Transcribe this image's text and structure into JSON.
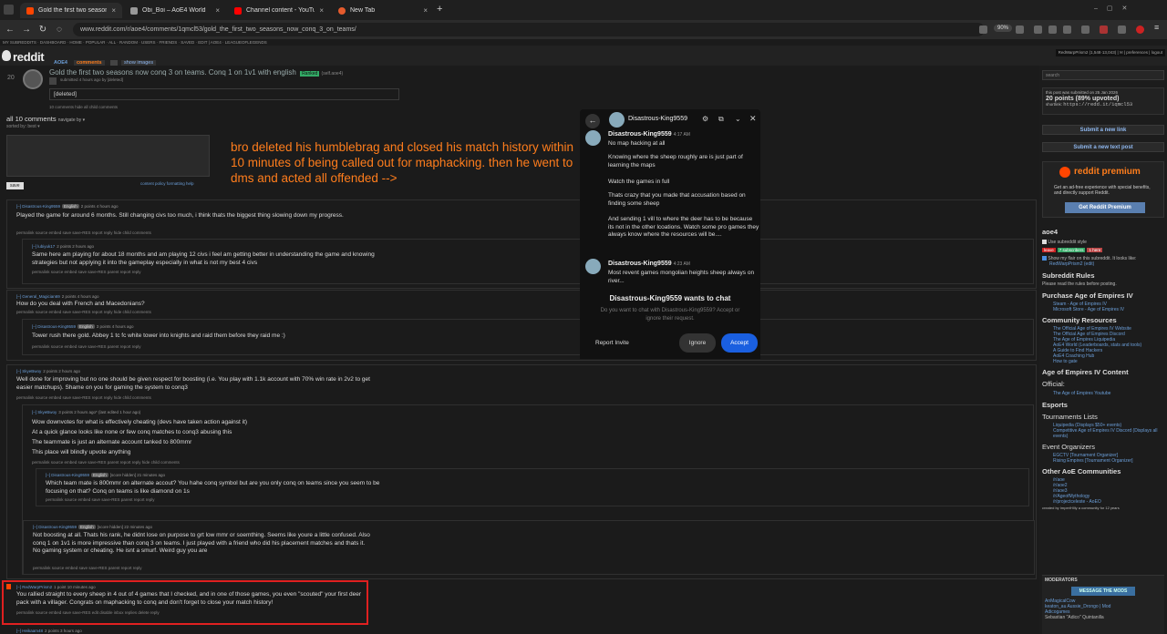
{
  "browser": {
    "tabs": [
      {
        "title": "Gold the first two seasons now",
        "color": "#ff4500"
      },
      {
        "title": "Obi_Boi – AoE4 World",
        "color": "#888888"
      },
      {
        "title": "Channel content - YouTube Stu",
        "color": "#ff0000"
      },
      {
        "title": "New Tab",
        "color": "#e55b2d"
      }
    ],
    "url": "www.reddit.com/r/aoe4/comments/1qmcl53/gold_the_first_two_seasons_now_conq_3_on_teams/",
    "zoom": "90%"
  },
  "srbar": "MY SUBREDDITS · DASHBOARD · HOME · POPULAR · ALL · RANDOM · USERS · FRIENDS · SAVED · EDIT | AOE4 · LEAGUEOFLEGENDS",
  "header": {
    "logo": "reddit",
    "subreddit": "AOE4",
    "tab_comments": "comments",
    "tab_images": "show images",
    "user": "RedWarpPrism2 (1,548·13,043) | ✉ | preferences | logout"
  },
  "post": {
    "score": "20",
    "title": "Gold the first two seasons now conq 3 on teams. Conq 1 on 1v1 with english",
    "flair": "Ranked",
    "domain": "(self.aoe4)",
    "tagline": "submitted 4 hours ago by [deleted]",
    "body": "[deleted]",
    "links": "10 comments   hide all child comments"
  },
  "comments_header": {
    "all": "all 10 comments",
    "navigate": "navigate by ▾",
    "sorted": "sorted by: best ▾",
    "content_policy": "content policy   formatting help",
    "save": "save"
  },
  "annotation": "bro deleted his humblebrag and closed his match history within 10 minutes of being called out for maphacking. then he went to dms and acted all offended -->",
  "comments": [
    {
      "head": "[–] Disastrous-King9559",
      "badge": "English",
      "meta": "2 points 4 hours ago",
      "text": "Played the game for around 6 months. Still changing civs too much, i think thats the biggest thing slowing down my progress.",
      "links": "permalink  source  embed  save  save-RES  report  reply  hide child comments"
    },
    {
      "head": "[–] lubiyuk17",
      "badge": "",
      "meta": "2 points 2 hours ago",
      "text": "Same here am playing for about 18 months and am playing 12 civs i feel am getting better in understanding the game and knowing strategies but not applying it into the gameplay especially in what is not my best 4 civs",
      "links": "permalink  source  embed  save  save-RES  parent  report  reply"
    },
    {
      "head": "[–] General_Magician69",
      "badge": "",
      "meta": "2 points 4 hours ago",
      "text": "How do you deal with French and Macedonians?",
      "links": "permalink  source  embed  save  save-RES  report  reply  hide child comments"
    },
    {
      "head": "[–] Disastrous-King9559",
      "badge": "English",
      "meta": "3 points 4 hours ago",
      "text": "Tower rush there gold. Abbey 1 tc fc white tower into knights and raid them before they raid me :)",
      "links": "permalink  source  embed  save  save-RES  parent  report  reply"
    },
    {
      "head": "[–] SkyeBwoy",
      "badge": "",
      "meta": "2 points 2 hours ago",
      "text": "Well done for improving but no one should be given respect for boosting (i.e. You play with 1.1k account with 70% win rate in 2v2 to get easier matchups). Shame on you for gaming the system to conq3",
      "links": "permalink  source  embed  save  save-RES  report  reply  hide child comments"
    },
    {
      "head": "[–] SkyeBwoy",
      "badge": "",
      "meta": "3 points 2 hours ago* (last edited 1 hour ago)",
      "text": "Wow downvotes for what is effectively cheating (devs have taken action against it)",
      "text2": "At a quick glance looks like none or few conq matches to conq3 abusing this",
      "text3": "The teammate is just an alternate account tanked to 800mmr",
      "text4": "This place will blindly upvote anything",
      "links": "permalink  source  embed  save  save-RES  parent  report  reply  hide child comments"
    },
    {
      "head": "[–] Disastrous-King9559",
      "badge": "English",
      "meta": "[score hidden] 21 minutes ago",
      "text": "Which team mate is 800mmr on alternate accout? You hahe conq symbol but are you only conq on teams since you seem to be focusing on that? Conq on teams is like diamond on 1s",
      "links": "permalink  source  embed  save  save-RES  parent  report  reply"
    },
    {
      "head": "[–] Disastrous-King9559",
      "badge": "English",
      "meta": "[score hidden] 22 minutes ago",
      "text": "Not boosting at all. Thats his rank, he didnt lose on purpose to grt low mmr or soemthing. Seems like youre a little confused. Also conq 1 on 1v1 is more impressive than conq 3 on teams. I just played with a friend who did his placement matches and thats it. No gaming system or cheating. He isnt a smurf. Weird guy you are",
      "links": "permalink  source  embed  save  save-RES  parent  report  reply"
    },
    {
      "head": "[–] RedWarpPrism2",
      "badge": "",
      "meta": "1 point 10 minutes ago",
      "text": "You rallied straight to every sheep in 4 out of 4 games that I checked, and in one of those games, you even \"scouted\" your first deer pack with a villager. Congrats on maphacking to conq and don't forget to close your match history!",
      "links": "permalink  source  embed  save  save-RES  edit  disable inbox replies  delete  reply"
    },
    {
      "head": "[–] Heikaam48",
      "badge": "",
      "meta": "2 points 3 hours ago",
      "text": "",
      "links": ""
    }
  ],
  "sidebar": {
    "search": "search",
    "submitted": "this post was submitted on 25 Jan 2026",
    "points": "20 points (89% upvoted)",
    "shortlink_label": "shortlink:",
    "shortlink": "https://redd.it/1qmcl53",
    "submit_link": "Submit a new link",
    "submit_text": "Submit a new text post",
    "premium_title": "reddit premium",
    "premium_text": "Get an ad-free experience with special benefits, and directly support Reddit.",
    "premium_btn": "Get Reddit Premium",
    "sub_name": "aoe4",
    "use_style": "Use subreddit style",
    "leave": "leave",
    "subs": "7 subscribers",
    "here": "1 here",
    "show_flair": "Show my flair on this subreddit. It looks like:",
    "flair_user": "RedWarpPrism2 (edit)",
    "rules_h": "Subreddit Rules",
    "rules_text": "Please read the rules before posting.",
    "purchase_h": "Purchase Age of Empires IV",
    "purchase_links": [
      "Steam - Age of Empires IV",
      "Microsoft Store - Age of Empires IV"
    ],
    "community_h": "Community Resources",
    "community_links": [
      "The Official Age of Empires IV Website",
      "The Official Age of Empires Discord",
      "The Age of Empires Liquipedia",
      "AoE4 World (Leaderboards, stats and tools)",
      "A Guide to Find Hackers",
      "AoE4 Coaching Hub",
      "How to gate"
    ],
    "content_h": "Age of Empires IV Content",
    "official_h": "Official:",
    "official_links": [
      "The Age of Empires Youtube"
    ],
    "esports_h": "Esports",
    "tourn_h": "Tournaments Lists",
    "tourn_links": [
      "Liquipedia (Displays $50+ events)",
      "Competitive Age of Empires IV Discord (Displays all events)"
    ],
    "orgs_h": "Event Organizers",
    "orgs_links": [
      "EGCTV [Tournament Organizer]",
      "Rising Empires [Tournament Organizer]"
    ],
    "other_h": "Other AoE Communities",
    "other_links": [
      "/r/aoe",
      "/r/aoe2",
      "/r/aoe3",
      "/r/AgeofMythology",
      "/r/projectceleste - AoEO"
    ],
    "created": "created by ImperiHIlly    a community for 12 years",
    "mods_h": "MODERATORS",
    "msg_mods": "MESSAGE THE MODS",
    "mods": [
      "AnMagicalCow",
      "keaton_au   Aussie_Drongo | Mod",
      "Adicogames",
      "Sebastian \"Adico\" Quintanilla"
    ]
  },
  "chat": {
    "name": "Disastrous-King9559",
    "msg1_time": "4:17 AM",
    "msg1": [
      "No map hacking at all",
      "Knowing where the sheep roughly are is just part of learning the maps",
      "Watch the games in full",
      "Thats crazy that you made that accusation based on finding some sheep",
      "And sending 1 vill to where the deer has to be because its not in the other lcoations. Watch some pro games they always know where the resources will be...."
    ],
    "msg2_time": "4:23 AM",
    "msg2": "Most revent games mongolian heights sheep always on river...",
    "wants": "Disastrous-King9559 wants to chat",
    "prompt": "Do you want to chat with Disastrous-King9559? Accept or ignore their request.",
    "report": "Report Invite",
    "ignore": "Ignore",
    "accept": "Accept"
  }
}
